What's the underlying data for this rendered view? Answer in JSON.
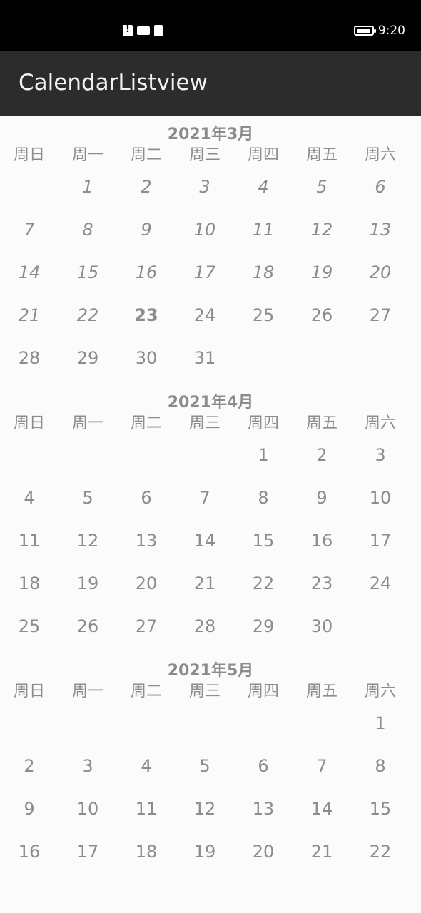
{
  "status_bar": {
    "time": "9:20",
    "icons": [
      "alert-icon",
      "video-icon",
      "file-icon",
      "battery-icon"
    ]
  },
  "app_bar": {
    "title": "CalendarListview"
  },
  "weekdays": [
    "周日",
    "周一",
    "周二",
    "周三",
    "周四",
    "周五",
    "周六"
  ],
  "months": [
    {
      "title": "2021年3月",
      "weeks": [
        [
          "",
          "1",
          "2",
          "3",
          "4",
          "5",
          "6"
        ],
        [
          "7",
          "8",
          "9",
          "10",
          "11",
          "12",
          "13"
        ],
        [
          "14",
          "15",
          "16",
          "17",
          "18",
          "19",
          "20"
        ],
        [
          "21",
          "22",
          "23",
          "24",
          "25",
          "26",
          "27"
        ],
        [
          "28",
          "29",
          "30",
          "31",
          "",
          "",
          ""
        ]
      ],
      "today": "23",
      "past_before": 23
    },
    {
      "title": "2021年4月",
      "weeks": [
        [
          "",
          "",
          "",
          "",
          "1",
          "2",
          "3"
        ],
        [
          "4",
          "5",
          "6",
          "7",
          "8",
          "9",
          "10"
        ],
        [
          "11",
          "12",
          "13",
          "14",
          "15",
          "16",
          "17"
        ],
        [
          "18",
          "19",
          "20",
          "21",
          "22",
          "23",
          "24"
        ],
        [
          "25",
          "26",
          "27",
          "28",
          "29",
          "30",
          ""
        ]
      ]
    },
    {
      "title": "2021年5月",
      "weeks": [
        [
          "",
          "",
          "",
          "",
          "",
          "",
          "1"
        ],
        [
          "2",
          "3",
          "4",
          "5",
          "6",
          "7",
          "8"
        ],
        [
          "9",
          "10",
          "11",
          "12",
          "13",
          "14",
          "15"
        ],
        [
          "16",
          "17",
          "18",
          "19",
          "20",
          "21",
          "22"
        ]
      ]
    }
  ]
}
